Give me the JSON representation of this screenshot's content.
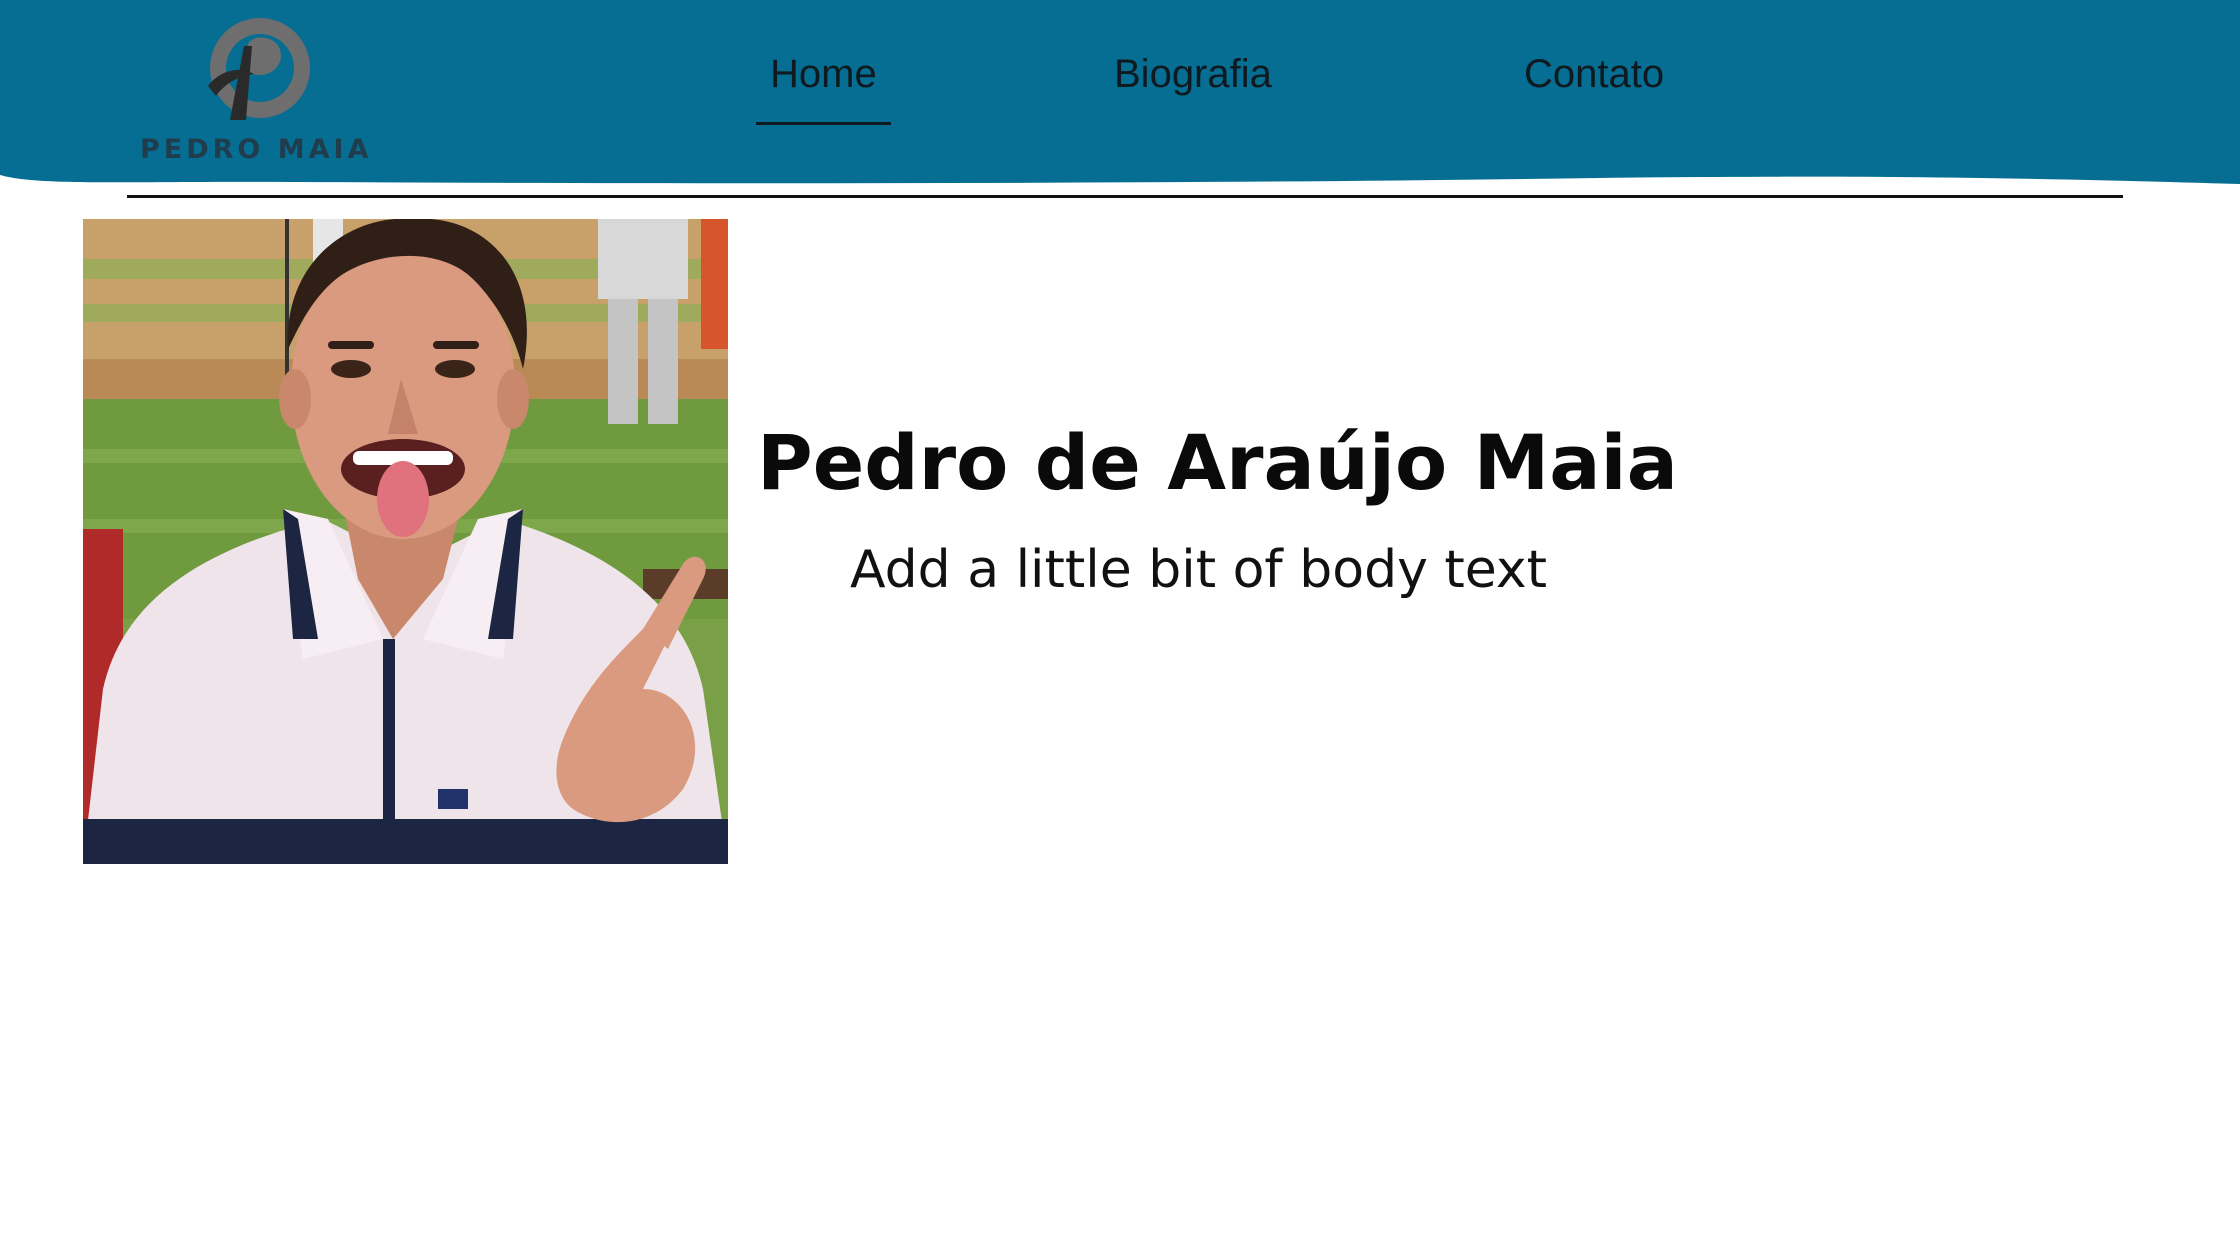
{
  "colors": {
    "header_bg": "#056e92",
    "logo_gray": "#6e6e6e",
    "logo_text": "#1f3d4d",
    "nav_text": "#0f1a20",
    "divider": "#111111",
    "text": "#0a0a0a",
    "page_bg": "#ffffff"
  },
  "header": {
    "logo": {
      "icon": "p-monogram-logo-icon",
      "name": "PEDRO MAIA"
    },
    "nav": {
      "items": [
        {
          "label": "Home",
          "active": true
        },
        {
          "label": "Biografia",
          "active": false
        },
        {
          "label": "Contato",
          "active": false
        }
      ]
    }
  },
  "hero": {
    "photo_icon": "profile-photo",
    "title": "Pedro de Araújo Maia",
    "body": "Add a little bit of body text"
  }
}
